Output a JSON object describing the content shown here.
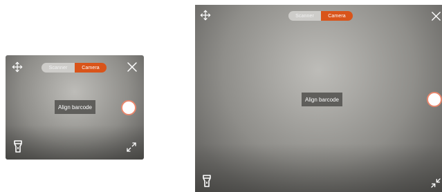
{
  "scanner_small": {
    "mode_toggle": {
      "options": [
        "Scanner",
        "Camera"
      ],
      "selected": "Camera"
    },
    "hint": "Align barcode",
    "icons": {
      "move": "move-arrows-icon",
      "close": "close-icon",
      "capture": "shutter-button",
      "flashlight": "flashlight-icon",
      "expand": "expand-icon"
    }
  },
  "scanner_large": {
    "mode_toggle": {
      "options": [
        "Scanner",
        "Camera"
      ],
      "selected": "Camera"
    },
    "hint": "Align barcode",
    "icons": {
      "move": "move-arrows-icon",
      "close": "close-icon",
      "capture": "shutter-button",
      "flashlight": "flashlight-icon",
      "collapse": "collapse-icon"
    }
  },
  "colors": {
    "accent": "#d9541a",
    "toggle_inactive": "#cdccc9",
    "hint_background": "#5f5e5b",
    "shutter_ring": "#e9876d"
  }
}
